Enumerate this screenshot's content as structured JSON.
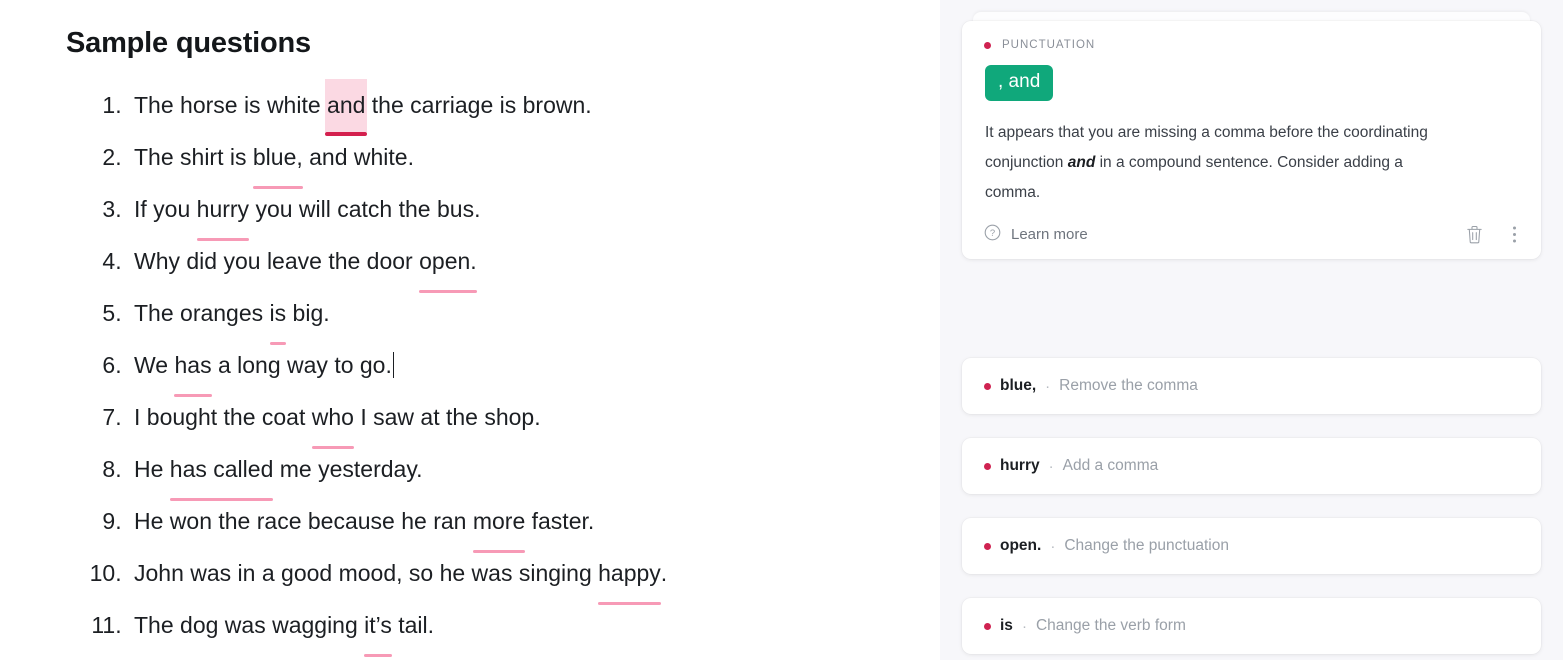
{
  "document": {
    "title": "Sample questions",
    "sentences": [
      {
        "pre": "The horse is white ",
        "mark": "and",
        "post": " the carriage is brown.",
        "active": true
      },
      {
        "pre": "The shirt is ",
        "mark": "blue,",
        "post": " and white.",
        "active": false
      },
      {
        "pre": "If you ",
        "mark": "hurry",
        "post": " you will catch the bus.",
        "active": false
      },
      {
        "pre": "Why did you leave the door ",
        "mark": "open.",
        "post": "",
        "active": false
      },
      {
        "pre": "The oranges ",
        "mark": "is",
        "post": " big.",
        "active": false
      },
      {
        "pre": "We ",
        "mark": "has",
        "post": " a long way to go.",
        "active": false,
        "caret": true
      },
      {
        "pre": "I bought the coat ",
        "mark": "who",
        "post": " I saw at the shop.",
        "active": false
      },
      {
        "pre": "He ",
        "mark": "has called",
        "post": " me yesterday.",
        "active": false
      },
      {
        "pre": "He won the race because he ran ",
        "mark": "more",
        "post": " faster.",
        "active": false
      },
      {
        "pre": "John was in a good mood, so he was singing ",
        "mark": "happy",
        "post": ".",
        "active": false
      },
      {
        "pre": "The dog was wagging ",
        "mark": "it’s",
        "post": " tail.",
        "active": false
      }
    ]
  },
  "sidebar": {
    "main_card": {
      "category": "PUNCTUATION",
      "suggestion_chip": ", and",
      "explanation_part1": "It appears that you are missing a comma before the coordinating conjunction ",
      "explanation_emphasis": "and",
      "explanation_part2": " in a compound sentence. Consider adding a comma.",
      "learn_more_label": "Learn more",
      "delete_title": "Delete",
      "more_title": "More options"
    },
    "suggestions": [
      {
        "word": "blue,",
        "separator": "·",
        "action": "Remove the comma"
      },
      {
        "word": "hurry",
        "separator": "·",
        "action": "Add a comma"
      },
      {
        "word": "open.",
        "separator": "·",
        "action": "Change the punctuation"
      },
      {
        "word": "is",
        "separator": "·",
        "action": "Change the verb form"
      }
    ]
  },
  "colors": {
    "accent_red": "#cf2251",
    "chip_green": "#10a87b",
    "underline_pink": "#f79ab6",
    "active_underline": "#d4204e",
    "active_highlight": "#fbd9e3",
    "sidebar_bg": "#f7f7fa"
  }
}
